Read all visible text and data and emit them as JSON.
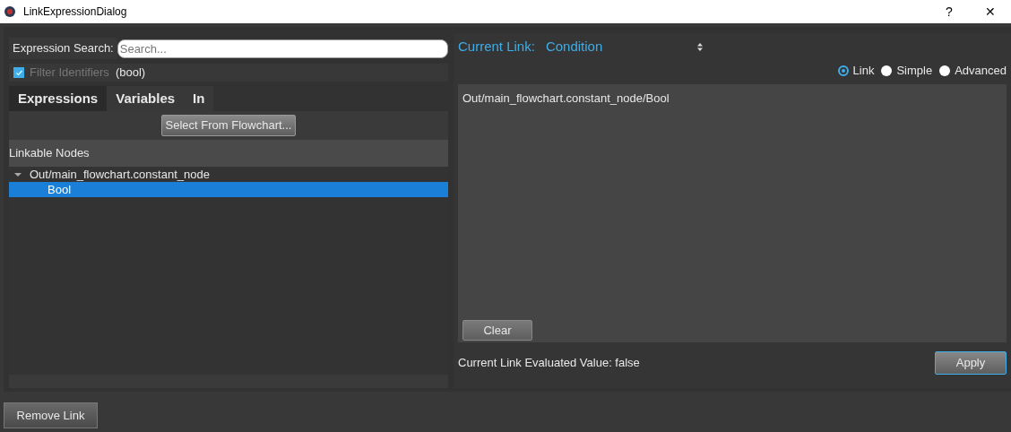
{
  "window": {
    "title": "LinkExpressionDialog",
    "help": "?",
    "close": "✕"
  },
  "left": {
    "search_label": "Expression Search:",
    "search_placeholder": "Search...",
    "filter": {
      "label": "Filter Identifiers",
      "checked": true,
      "disabled": true,
      "value": "(bool)"
    },
    "tabs": [
      {
        "label": "Expressions",
        "selected": true
      },
      {
        "label": "Variables",
        "selected": false
      },
      {
        "label": "In",
        "selected": false
      }
    ],
    "select_button": "Select From Flowchart...",
    "tree_header": "Linkable Nodes",
    "tree": [
      {
        "label": "Out/main_flowchart.constant_node",
        "expanded": true,
        "selected": false,
        "children": [
          {
            "label": "Bool",
            "selected": true
          }
        ]
      }
    ]
  },
  "right": {
    "current_link_label": "Current Link:",
    "current_link_value": "Condition",
    "modes": [
      {
        "label": "Link",
        "selected": true
      },
      {
        "label": "Simple",
        "selected": false
      },
      {
        "label": "Advanced",
        "selected": false
      }
    ],
    "expression": "Out/main_flowchart.constant_node/Bool",
    "clear_button": "Clear",
    "evaluated": "Current Link Evaluated Value: false",
    "apply_button": "Apply"
  },
  "remove_button": "Remove Link"
}
